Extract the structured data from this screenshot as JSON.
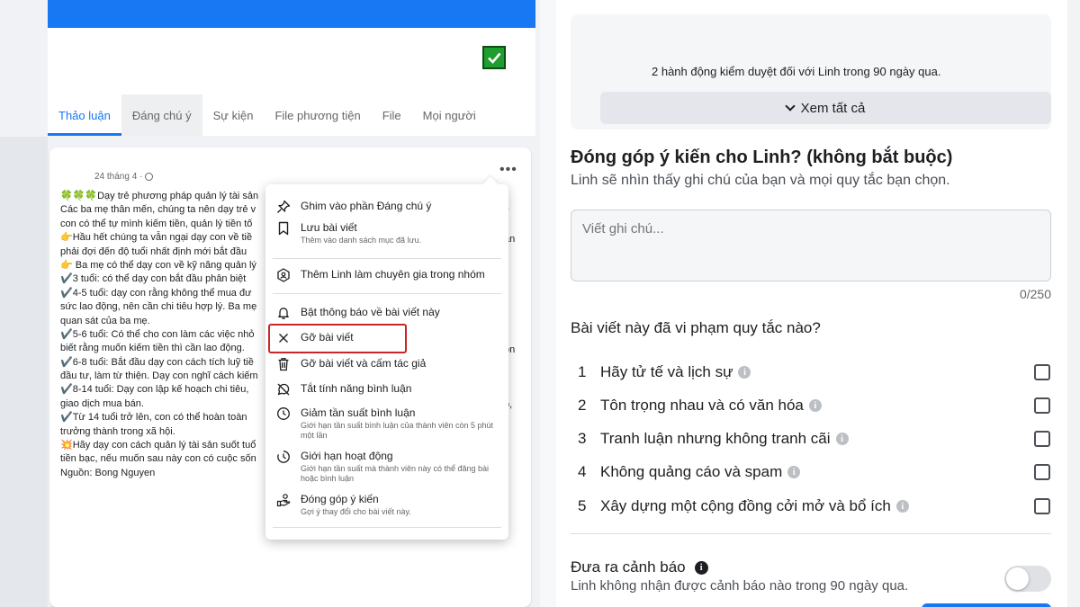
{
  "group": {
    "tabs": [
      {
        "label": "Thảo luận"
      },
      {
        "label": "Đáng chú ý"
      },
      {
        "label": "Sự kiện"
      },
      {
        "label": "File phương tiện"
      },
      {
        "label": "File"
      },
      {
        "label": "Mọi người"
      }
    ],
    "active_tab": "Thảo luận",
    "accent": "#1877f2"
  },
  "post": {
    "date": "24 tháng 4 ·",
    "lines": [
      "🍀🍀🍀Dạy trẻ phương pháp quản lý tài sản",
      "Các ba mẹ thân mến, chúng ta nên dạy trẻ v",
      "con có thể tự mình kiếm tiền, quản lý tiền tố",
      "👉Hầu hết chúng ta vẫn ngại dạy con về tiề",
      "phải đợi đến độ tuổi nhất định mới bắt đầu",
      "👉 Ba mẹ có thể dạy con về kỹ năng quản lý",
      "✔️3 tuổi: có thể dạy con bắt đầu phân biệt",
      "✔️4-5 tuổi: dạy con rằng không thể mua đư",
      "sức lao động, nên cần chi tiêu hợp lý. Ba mẹ",
      "quan sát của ba mẹ.",
      "✔️5-6 tuổi: Có thể cho con làm các việc nhỏ",
      "biết rằng muốn kiếm tiền thì cần lao động.",
      "✔️6-8 tuổi: Bắt đầu dạy con cách tích luỹ tiề",
      "đầu tư, làm từ thiện. Dạy con nghĩ cách kiếm",
      "✔️8-14 tuổi: Dạy con lập kế hoạch chi tiêu,",
      "giao dịch mua bán.",
      "✔️Từ 14 tuổi trở lên, con có thể hoàn toàn",
      "trưởng thành trong xã hội.",
      "💥Hãy dạy con cách quản lý tài sản suốt tuổ",
      "tiền bạc, nếu muốn sau này con có cuộc sốn",
      "Nguồn: Bong Nguyen"
    ],
    "right_fragments": [
      "y",
      "",
      "ăn",
      "",
      "",
      "",
      "",
      "",
      "",
      "",
      "on",
      "",
      "",
      "",
      "o,"
    ]
  },
  "menu": {
    "items": [
      {
        "icon": "pin-icon",
        "label": "Ghim vào phần Đáng chú ý",
        "sub": ""
      },
      {
        "icon": "bookmark-icon",
        "label": "Lưu bài viết",
        "sub": "Thêm vào danh sách mục đã lưu."
      },
      {
        "icon": "expert-badge-icon",
        "label": "Thêm Linh làm chuyên gia trong nhóm",
        "sub": ""
      },
      {
        "icon": "bell-icon",
        "label": "Bật thông báo về bài viết này",
        "sub": ""
      },
      {
        "icon": "close-icon",
        "label": "Gỡ bài viết",
        "sub": ""
      },
      {
        "icon": "trash-icon",
        "label": "Gỡ bài viết và cấm tác giả",
        "sub": ""
      },
      {
        "icon": "comment-off-icon",
        "label": "Tắt tính năng bình luận",
        "sub": ""
      },
      {
        "icon": "slow-clock-icon",
        "label": "Giảm tần suất bình luận",
        "sub": "Giới hạn tần suất bình luận của thành viên còn 5 phút một lần"
      },
      {
        "icon": "limit-icon",
        "label": "Giới hạn hoạt động",
        "sub": "Giới hạn tần suất mà thành viên này có thể đăng bài hoặc bình luận"
      },
      {
        "icon": "feedback-icon",
        "label": "Đóng góp ý kiến",
        "sub": "Gợi ý thay đổi cho bài viết này."
      }
    ],
    "highlight_color": "#c62828"
  },
  "dialog": {
    "moderation_note": "2 hành động kiểm duyệt đối với Linh trong 90 ngày qua.",
    "see_all": "Xem tất cả",
    "feedback_title": "Đóng góp ý kiến cho Linh? (không bắt buộc)",
    "feedback_sub": "Linh sẽ nhìn thấy ghi chú của bạn và mọi quy tắc bạn chọn.",
    "note_placeholder": "Viết ghi chú...",
    "note_counter": "0/250",
    "rules_question": "Bài viết này đã vi phạm quy tắc nào?",
    "rules": [
      {
        "num": "1",
        "label": "Hãy tử tế và lịch sự",
        "checked": false
      },
      {
        "num": "2",
        "label": "Tôn trọng nhau và có văn hóa",
        "checked": false
      },
      {
        "num": "3",
        "label": "Tranh luận nhưng không tranh cãi",
        "checked": false
      },
      {
        "num": "4",
        "label": "Không quảng cáo và spam",
        "checked": false
      },
      {
        "num": "5",
        "label": "Xây dựng một cộng đồng cởi mở và bổ ích",
        "checked": false
      }
    ],
    "warning_title": "Đưa ra cảnh báo",
    "warning_sub": "Linh không nhận được cảnh báo nào trong 90 ngày qua.",
    "warning_enabled": false
  }
}
